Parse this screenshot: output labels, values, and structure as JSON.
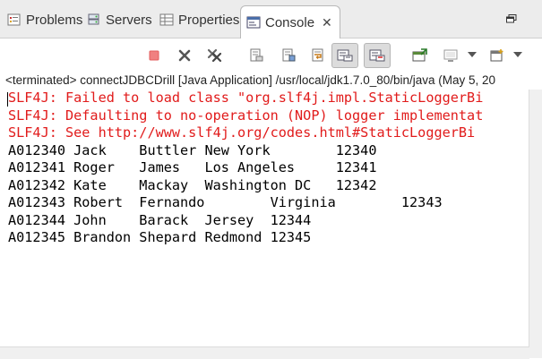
{
  "tabs": [
    {
      "label": "Problems",
      "icon": "problems-icon"
    },
    {
      "label": "Servers",
      "icon": "servers-icon"
    },
    {
      "label": "Properties",
      "icon": "properties-icon"
    },
    {
      "label": "Console",
      "icon": "console-icon",
      "active": true
    }
  ],
  "tab_close_glyph": "✕",
  "status": "<terminated> connectJDBCDrill [Java Application] /usr/local/jdk1.7.0_80/bin/java (May 5, 20",
  "console": {
    "error_lines": [
      "SLF4J: Failed to load class \"org.slf4j.impl.StaticLoggerBi",
      "SLF4J: Defaulting to no-operation (NOP) logger implementat",
      "SLF4J: See http://www.slf4j.org/codes.html#StaticLoggerBi"
    ],
    "output_lines": [
      "A012340 Jack    Buttler New York        12340",
      "A012341 Roger   James   Los Angeles     12341",
      "A012342 Kate    Mackay  Washington DC   12342",
      "A012343 Robert  Fernando        Virginia        12343",
      "A012344 John    Barack  Jersey  12344",
      "A012345 Brandon Shepard Redmond 12345"
    ]
  },
  "colors": {
    "error_text": "#e11b1b",
    "tab_bar": "#ececec"
  }
}
